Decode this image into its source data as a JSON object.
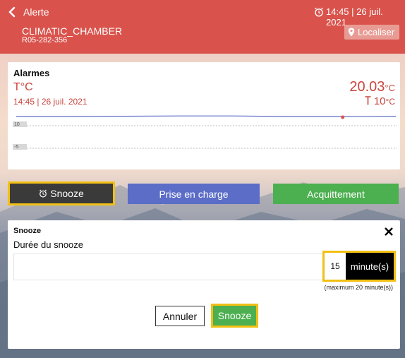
{
  "header": {
    "title": "Alerte",
    "datetime": "14:45 | 26 juil. 2021",
    "device_name": "CLIMATIC_CHAMBER",
    "device_id": "R05-282-356",
    "locate_label": "Localiser",
    "color": "#d9534c"
  },
  "alarm_card": {
    "title": "Alarmes",
    "metric": "T°C",
    "datetime": "14:45 | 26 juil. 2021",
    "value": "20.03",
    "value_unit": "°C",
    "threshold": "10",
    "threshold_unit": "°C"
  },
  "chart_data": {
    "type": "line",
    "series": [
      {
        "values": [
          20.0,
          20.0,
          20.05,
          20.1,
          20.1,
          20.0,
          20.0,
          20.03
        ]
      }
    ],
    "markers": [
      "10",
      "-5"
    ],
    "grid": true
  },
  "actions": {
    "snooze_label": "Snooze",
    "prise_label": "Prise en charge",
    "acquit_label": "Acquittement",
    "colors": {
      "snooze": "#3a3a3a",
      "prise": "#5b6dc7",
      "acquit": "#4caf50",
      "highlight": "#f2c014"
    }
  },
  "snooze_panel": {
    "title": "Snooze",
    "subtitle": "Durée du snooze",
    "duration_value": "15",
    "duration_unit": "minute(s)",
    "max_note": "(maximum 20 minute(s))",
    "cancel_label": "Annuler",
    "confirm_label": "Snooze"
  }
}
